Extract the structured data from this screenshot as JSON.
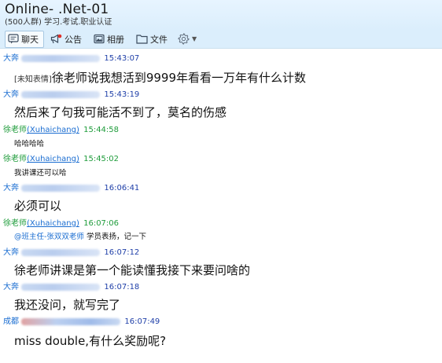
{
  "window": {
    "title": "Online- .Net-01",
    "subtitle": "(500人群) 学习.考试.职业认证"
  },
  "toolbar": {
    "chat": "聊天",
    "notice": "公告",
    "album": "相册",
    "files": "文件"
  },
  "messages": [
    {
      "sender": "大奔",
      "time": "15:43:07",
      "prefix": "[未知表情]",
      "text": "徐老师说我想活到9999年看看一万年有什么计数"
    },
    {
      "sender": "大奔",
      "time": "15:43:19",
      "text": "然后来了句我可能活不到了，莫名的伤感"
    },
    {
      "sender": "徐老师",
      "sender_id": "Xuhaichang",
      "time": "15:44:58",
      "text": "哈哈哈哈"
    },
    {
      "sender": "徐老师",
      "sender_id": "Xuhaichang",
      "time": "15:45:02",
      "text": "我讲课还可以哈"
    },
    {
      "sender": "大奔",
      "time": "16:06:41",
      "text": "必须可以"
    },
    {
      "sender": "徐老师",
      "sender_id": "Xuhaichang",
      "time": "16:07:06",
      "mention": "@班主任-张双双老师",
      "text": " 学员表扬，记一下"
    },
    {
      "sender": "大奔",
      "time": "16:07:12",
      "text": "徐老师讲课是第一个能读懂我接下来要问啥的"
    },
    {
      "sender": "大奔",
      "time": "16:07:18",
      "text": "我还没问，就写完了"
    },
    {
      "sender": "成都",
      "time": "16:07:49",
      "text": "miss double,有什么奖励呢?"
    }
  ]
}
